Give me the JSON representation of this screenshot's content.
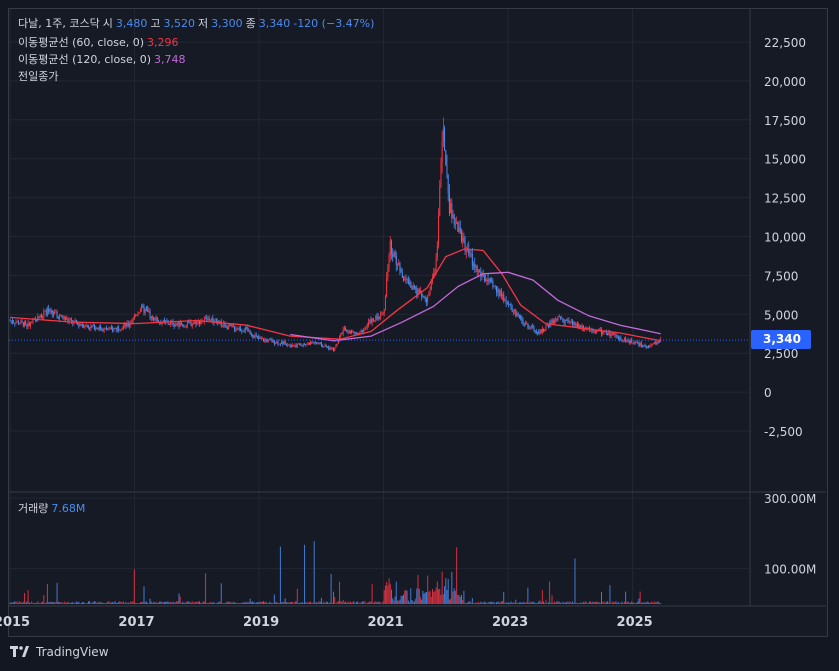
{
  "legend": {
    "ticker": "다날, 1주, 코스닥",
    "open_label": "시",
    "open": "3,480",
    "high_label": "고",
    "high": "3,520",
    "low_label": "저",
    "low": "3,300",
    "close_label": "종",
    "close": "3,340",
    "change": "-120 (−3.47%)",
    "ma60_label": "이동평균선 (60, close, 0)",
    "ma60_value": "3,296",
    "ma120_label": "이동평균선 (120, close, 0)",
    "ma120_value": "3,748",
    "prev_close_label": "전일종가",
    "volume_label": "거래량",
    "volume_value": "7.68M"
  },
  "price_tag": "3,340",
  "footer": {
    "brand": "TradingView"
  },
  "colors": {
    "up": "#f23645",
    "down": "#4a8cf0",
    "ma60": "#f23645",
    "ma120": "#c26ad8",
    "accent": "#2962ff"
  },
  "chart_data": {
    "type": "line",
    "x_ticks": [
      "2015",
      "2017",
      "2019",
      "2021",
      "2023",
      "2025"
    ],
    "price_ticks": [
      "22,500",
      "20,000",
      "17,500",
      "15,000",
      "12,500",
      "10,000",
      "7,500",
      "5,000",
      "2,500",
      "0",
      "-2,500"
    ],
    "volume_ticks": [
      "300.00M",
      "100.00M"
    ],
    "price_ylim": [
      -2500,
      22500
    ],
    "volume_ylim": [
      0,
      300000000
    ],
    "x_range": [
      2015.0,
      2025.6
    ],
    "price_anchors": [
      [
        2015.0,
        4600
      ],
      [
        2015.3,
        4300
      ],
      [
        2015.6,
        5200
      ],
      [
        2016.0,
        4500
      ],
      [
        2016.3,
        4200
      ],
      [
        2016.6,
        4000
      ],
      [
        2016.9,
        4300
      ],
      [
        2017.1,
        5400
      ],
      [
        2017.4,
        4500
      ],
      [
        2017.8,
        4300
      ],
      [
        2018.2,
        4700
      ],
      [
        2018.5,
        4200
      ],
      [
        2018.8,
        4000
      ],
      [
        2019.0,
        3400
      ],
      [
        2019.3,
        3200
      ],
      [
        2019.6,
        3000
      ],
      [
        2019.9,
        3200
      ],
      [
        2020.2,
        2700
      ],
      [
        2020.35,
        4000
      ],
      [
        2020.6,
        3700
      ],
      [
        2020.8,
        4600
      ],
      [
        2021.0,
        5000
      ],
      [
        2021.1,
        9500
      ],
      [
        2021.3,
        7500
      ],
      [
        2021.5,
        6500
      ],
      [
        2021.7,
        6000
      ],
      [
        2021.85,
        8500
      ],
      [
        2021.95,
        17000
      ],
      [
        2022.05,
        12000
      ],
      [
        2022.2,
        10500
      ],
      [
        2022.35,
        9000
      ],
      [
        2022.5,
        7800
      ],
      [
        2022.7,
        7000
      ],
      [
        2022.9,
        6200
      ],
      [
        2023.2,
        4600
      ],
      [
        2023.5,
        3800
      ],
      [
        2023.8,
        4800
      ],
      [
        2024.1,
        4300
      ],
      [
        2024.4,
        4000
      ],
      [
        2024.7,
        3600
      ],
      [
        2025.0,
        3200
      ],
      [
        2025.25,
        2900
      ],
      [
        2025.45,
        3340
      ]
    ],
    "series": [
      {
        "name": "이동평균선 (60, close, 0)",
        "color": "#f23645",
        "points": [
          [
            2015.0,
            4800
          ],
          [
            2016.0,
            4500
          ],
          [
            2017.0,
            4400
          ],
          [
            2018.0,
            4600
          ],
          [
            2018.8,
            4300
          ],
          [
            2019.5,
            3600
          ],
          [
            2020.3,
            3400
          ],
          [
            2020.8,
            3900
          ],
          [
            2021.2,
            5200
          ],
          [
            2021.7,
            6700
          ],
          [
            2022.0,
            8700
          ],
          [
            2022.3,
            9200
          ],
          [
            2022.6,
            9100
          ],
          [
            2022.9,
            7600
          ],
          [
            2023.2,
            5600
          ],
          [
            2023.6,
            4400
          ],
          [
            2024.2,
            4100
          ],
          [
            2024.8,
            3800
          ],
          [
            2025.45,
            3296
          ]
        ]
      },
      {
        "name": "이동평균선 (120, close, 0)",
        "color": "#c26ad8",
        "points": [
          [
            2019.5,
            3700
          ],
          [
            2020.2,
            3300
          ],
          [
            2020.8,
            3600
          ],
          [
            2021.3,
            4500
          ],
          [
            2021.8,
            5500
          ],
          [
            2022.2,
            6800
          ],
          [
            2022.6,
            7600
          ],
          [
            2023.0,
            7700
          ],
          [
            2023.4,
            7200
          ],
          [
            2023.8,
            5900
          ],
          [
            2024.3,
            4900
          ],
          [
            2024.8,
            4300
          ],
          [
            2025.45,
            3748
          ]
        ]
      }
    ]
  }
}
